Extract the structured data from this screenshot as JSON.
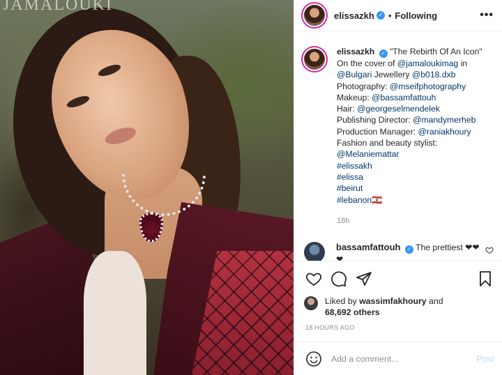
{
  "photo": {
    "brand": "JAMALOUKI"
  },
  "header": {
    "username": "elissazkh",
    "separator": "•",
    "follow_label": "Following",
    "more_label": "•••"
  },
  "caption": {
    "username": "elissazkh",
    "lines": [
      "\"The Rebirth Of An Icon\"",
      "On the cover of @jamaloukimag in",
      "@Bulgari Jewellery @b018.dxb",
      "Photography: @mseifphotography",
      "Makeup: @bassamfattouh",
      "Hair: @georgeselmendelek",
      "Publishing Director: @mandymerheb",
      "Production Manager: @raniakhoury",
      "Fashion and beauty stylist:",
      "@Melaniemattar",
      "#elissakh",
      "#elissa",
      "#beirut",
      "#lebanon🇱🇧"
    ],
    "time": "18h"
  },
  "comment": {
    "username": "bassamfattouh",
    "text": "The prettiest ❤❤",
    "text2": "❤"
  },
  "likes": {
    "prefix": "Liked by",
    "user": "wassimfakhoury",
    "and": "and",
    "others": "68,692 others"
  },
  "timestamp": "18 HOURS AGO",
  "add_comment": {
    "placeholder": "Add a comment...",
    "post_label": "Post"
  },
  "colors": {
    "link": "#00376b",
    "verified": "#3897f0",
    "muted": "#8e8e8e",
    "post_disabled": "#b2dffc"
  }
}
